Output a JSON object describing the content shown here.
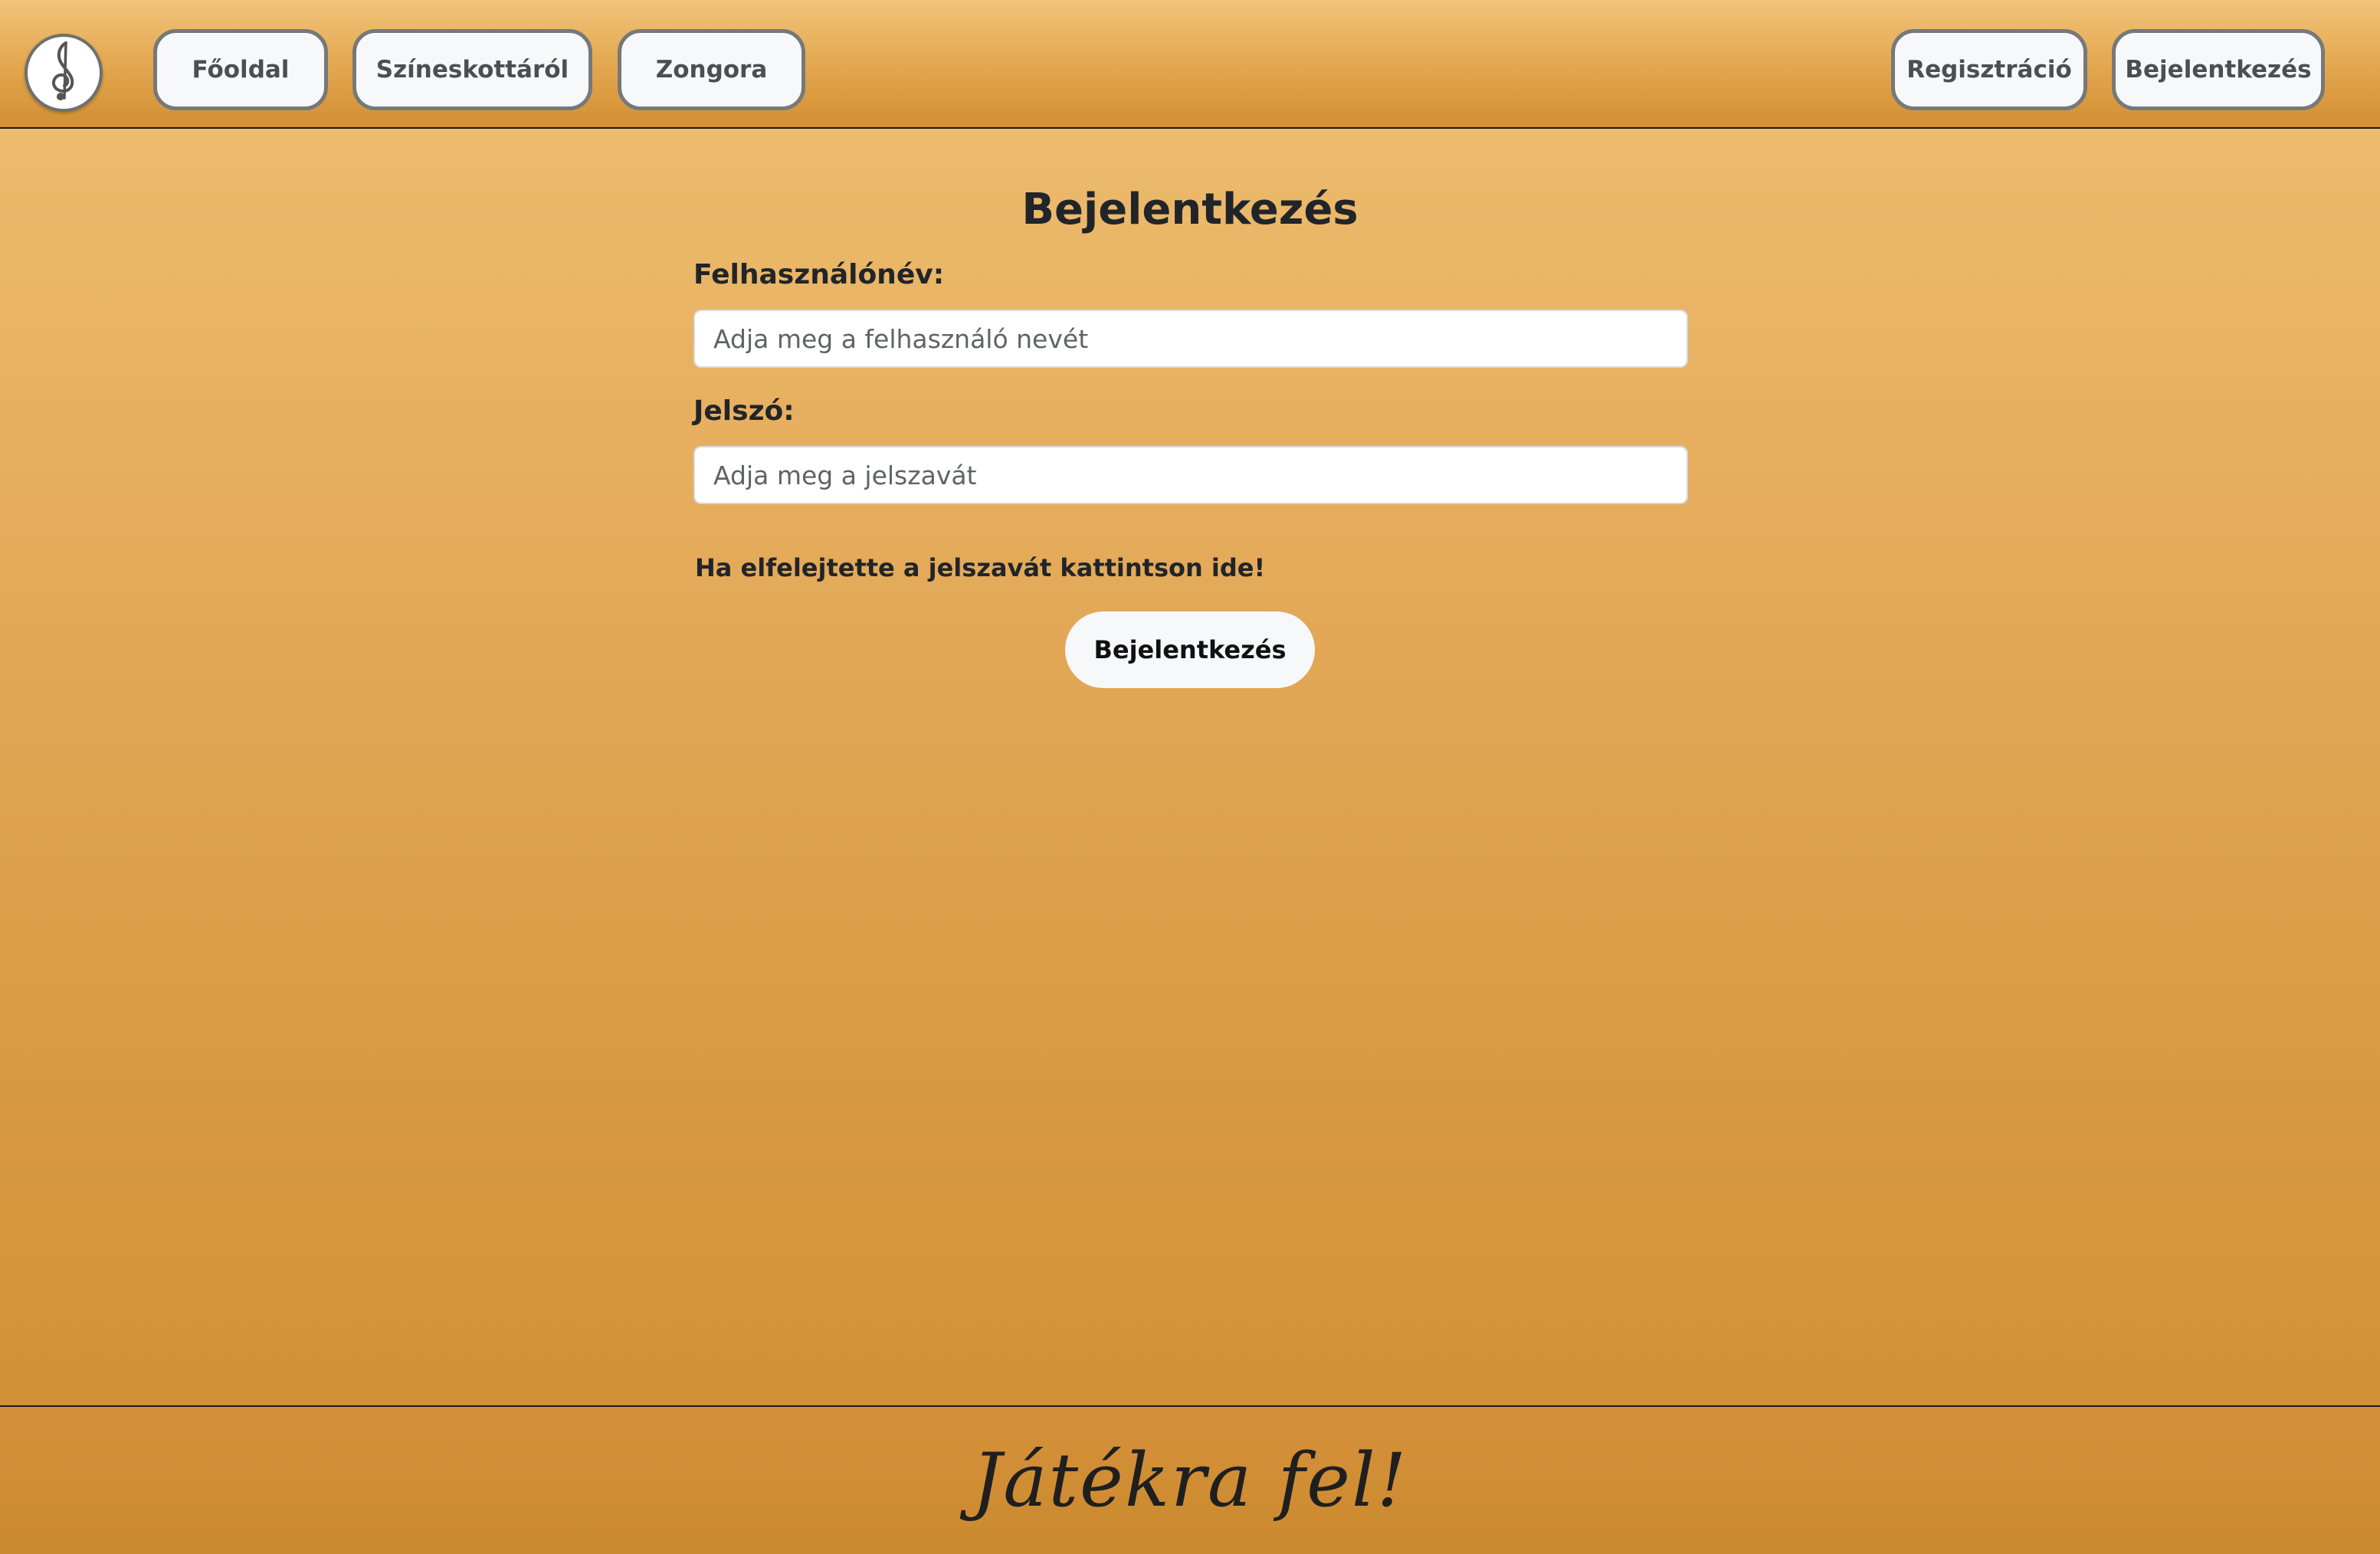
{
  "header": {
    "logo_icon": "treble-clef-icon",
    "nav": {
      "home": "Főoldal",
      "about_colored_notes": "Színeskottáról",
      "piano": "Zongora"
    },
    "account": {
      "register": "Regisztráció",
      "login": "Bejelentkezés"
    }
  },
  "login_form": {
    "title": "Bejelentkezés",
    "username_label": "Felhasználónév:",
    "username_placeholder": "Adja meg a felhasználó nevét",
    "username_value": "",
    "password_label": "Jelszó:",
    "password_placeholder": "Adja meg a jelszavát",
    "password_value": "",
    "forgot_password_link": "Ha elfelejtette a jelszavát kattintson ide!",
    "submit_label": "Bejelentkezés"
  },
  "footer": {
    "tagline": "Játékra fel!"
  },
  "colors": {
    "background_top": "#efc073",
    "background_bottom": "#cf8d32",
    "button_bg": "#f7f8fa",
    "button_border": "#76787a",
    "text": "#212529"
  }
}
